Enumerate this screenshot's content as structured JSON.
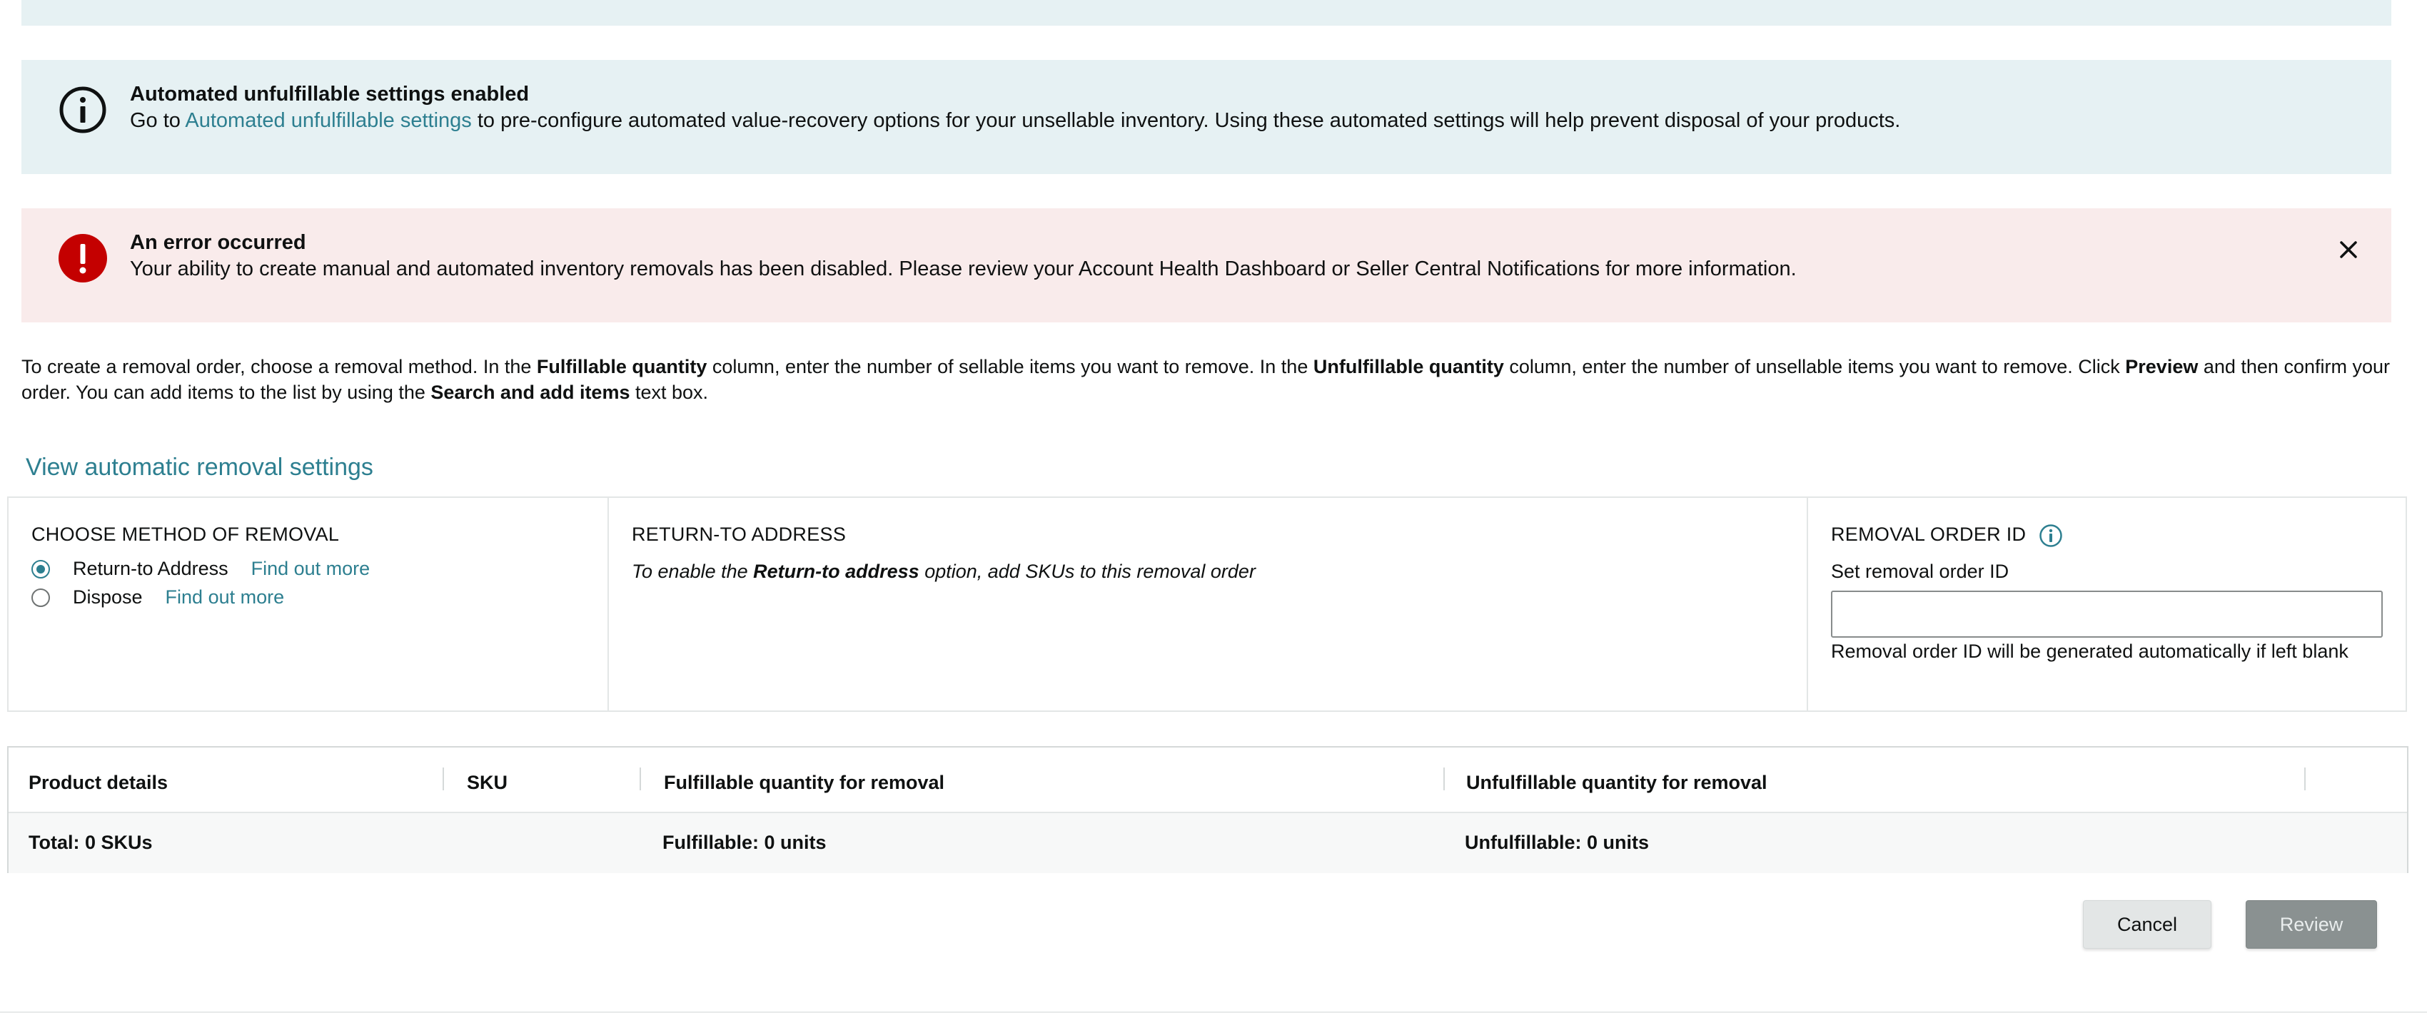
{
  "info_alert": {
    "title": "Automated unfulfillable settings enabled",
    "text_prefix": "Go to ",
    "link": "Automated unfulfillable settings",
    "text_suffix": " to pre-configure automated value-recovery options for your unsellable inventory. Using these automated settings will help prevent disposal of your products."
  },
  "error_alert": {
    "title": "An error occurred",
    "text": "Your ability to create manual and automated inventory removals has been disabled. Please review your Account Health Dashboard or Seller Central Notifications for more information."
  },
  "instructions": {
    "p1": "To create a removal order, choose a removal method. In the ",
    "b1": "Fulfillable quantity",
    "p2": " column, enter the number of sellable items you want to remove. In the ",
    "b2": "Unfulfillable quantity",
    "p3": " column, enter the number of unsellable items you want to remove. Click ",
    "b3": "Preview",
    "p4": " and then confirm your order. You can add items to the list by using the ",
    "b4": "Search and add items",
    "p5": " text box."
  },
  "auto_settings_link": "View automatic removal settings",
  "method": {
    "title": "CHOOSE METHOD OF REMOVAL",
    "options": [
      {
        "label": "Return-to Address",
        "link": "Find out more",
        "selected": true
      },
      {
        "label": "Dispose",
        "link": "Find out more",
        "selected": false
      }
    ]
  },
  "return_address": {
    "title": "RETURN-TO ADDRESS",
    "note_prefix": "To enable the ",
    "note_bold": "Return-to address",
    "note_suffix": " option, add SKUs to this removal order"
  },
  "removal_order": {
    "title": "REMOVAL ORDER ID",
    "label": "Set removal order ID",
    "value": "",
    "hint": "Removal order ID will be generated automatically if left blank"
  },
  "table": {
    "headers": [
      "Product details",
      "SKU",
      "Fulfillable quantity for removal",
      "Unfulfillable quantity for removal"
    ],
    "totals": {
      "skus": "Total: 0 SKUs",
      "fulfillable": "Fulfillable: 0 units",
      "unfulfillable": "Unfulfillable: 0 units"
    }
  },
  "buttons": {
    "cancel": "Cancel",
    "review": "Review"
  },
  "colors": {
    "link": "#2d7f90",
    "info_bg": "#e6f1f3",
    "error_bg": "#f9ebeb",
    "error_icon": "#c40000"
  },
  "icons": {
    "info": "info-circle-icon",
    "error": "exclamation-circle-icon",
    "close": "close-icon"
  }
}
